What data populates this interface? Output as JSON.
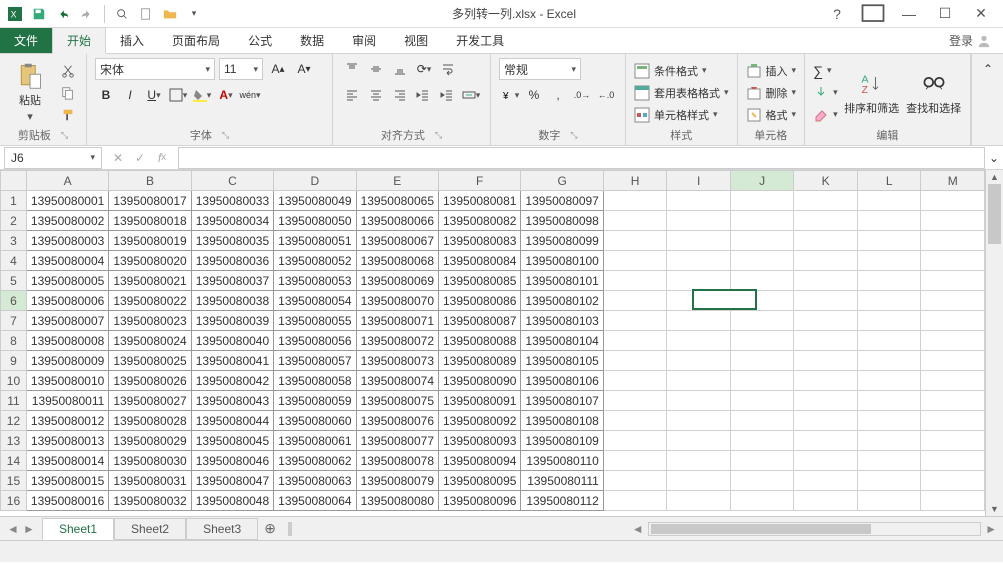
{
  "titlebar": {
    "title": "多列转一列.xlsx - Excel"
  },
  "ribbon_tabs": {
    "file": "文件",
    "tabs": [
      "开始",
      "插入",
      "页面布局",
      "公式",
      "数据",
      "审阅",
      "视图",
      "开发工具"
    ],
    "active": 0,
    "login": "登录"
  },
  "font": {
    "name": "宋体",
    "size": "11"
  },
  "number_format": "常规",
  "groups": {
    "clipboard": "剪贴板",
    "font": "字体",
    "align": "对齐方式",
    "number": "数字",
    "styles": "样式",
    "cells": "单元格",
    "editing": "编辑",
    "paste": "粘贴",
    "cond_fmt": "条件格式",
    "tbl_fmt": "套用表格格式",
    "cell_style": "单元格样式",
    "insert": "插入",
    "delete": "删除",
    "format": "格式",
    "sort_filter": "排序和筛选",
    "find_select": "查找和选择"
  },
  "namebox": "J6",
  "columns": [
    "A",
    "B",
    "C",
    "D",
    "E",
    "F",
    "G",
    "H",
    "I",
    "J",
    "K",
    "L",
    "M"
  ],
  "rows": [
    "1",
    "2",
    "3",
    "4",
    "5",
    "6",
    "7",
    "8",
    "9",
    "10",
    "11",
    "12",
    "13",
    "14",
    "15",
    "16"
  ],
  "data": [
    [
      "13950080001",
      "13950080017",
      "13950080033",
      "13950080049",
      "13950080065",
      "13950080081",
      "13950080097"
    ],
    [
      "13950080002",
      "13950080018",
      "13950080034",
      "13950080050",
      "13950080066",
      "13950080082",
      "13950080098"
    ],
    [
      "13950080003",
      "13950080019",
      "13950080035",
      "13950080051",
      "13950080067",
      "13950080083",
      "13950080099"
    ],
    [
      "13950080004",
      "13950080020",
      "13950080036",
      "13950080052",
      "13950080068",
      "13950080084",
      "13950080100"
    ],
    [
      "13950080005",
      "13950080021",
      "13950080037",
      "13950080053",
      "13950080069",
      "13950080085",
      "13950080101"
    ],
    [
      "13950080006",
      "13950080022",
      "13950080038",
      "13950080054",
      "13950080070",
      "13950080086",
      "13950080102"
    ],
    [
      "13950080007",
      "13950080023",
      "13950080039",
      "13950080055",
      "13950080071",
      "13950080087",
      "13950080103"
    ],
    [
      "13950080008",
      "13950080024",
      "13950080040",
      "13950080056",
      "13950080072",
      "13950080088",
      "13950080104"
    ],
    [
      "13950080009",
      "13950080025",
      "13950080041",
      "13950080057",
      "13950080073",
      "13950080089",
      "13950080105"
    ],
    [
      "13950080010",
      "13950080026",
      "13950080042",
      "13950080058",
      "13950080074",
      "13950080090",
      "13950080106"
    ],
    [
      "13950080011",
      "13950080027",
      "13950080043",
      "13950080059",
      "13950080075",
      "13950080091",
      "13950080107"
    ],
    [
      "13950080012",
      "13950080028",
      "13950080044",
      "13950080060",
      "13950080076",
      "13950080092",
      "13950080108"
    ],
    [
      "13950080013",
      "13950080029",
      "13950080045",
      "13950080061",
      "13950080077",
      "13950080093",
      "13950080109"
    ],
    [
      "13950080014",
      "13950080030",
      "13950080046",
      "13950080062",
      "13950080078",
      "13950080094",
      "13950080110"
    ],
    [
      "13950080015",
      "13950080031",
      "13950080047",
      "13950080063",
      "13950080079",
      "13950080095",
      "13950080111"
    ],
    [
      "13950080016",
      "13950080032",
      "13950080048",
      "13950080064",
      "13950080080",
      "13950080096",
      "13950080112"
    ]
  ],
  "col_widths": {
    "row": 26,
    "data": 77,
    "blank": 64
  },
  "active_cell": {
    "row": 6,
    "col": 10
  },
  "sheets": [
    "Sheet1",
    "Sheet2",
    "Sheet3"
  ],
  "active_sheet": 0
}
